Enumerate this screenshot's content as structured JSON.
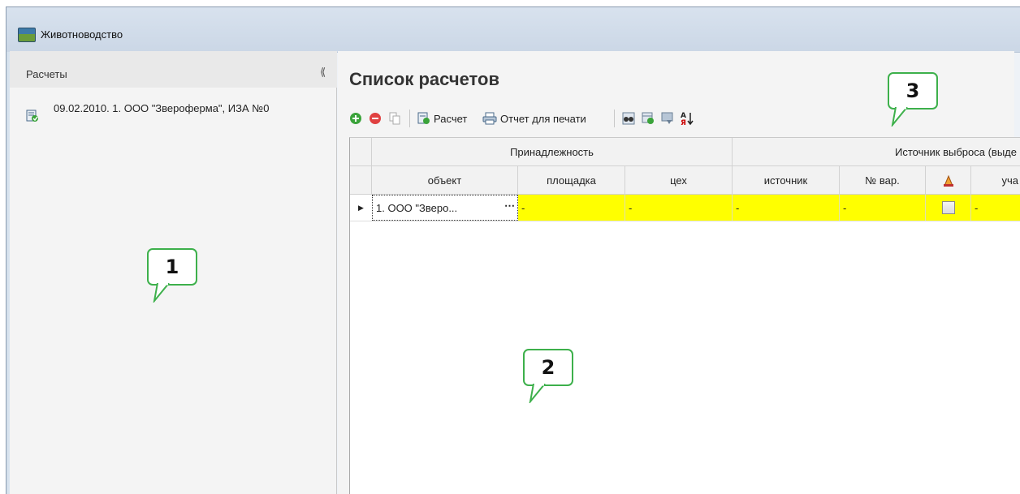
{
  "window": {
    "title": "Животноводство"
  },
  "left_panel": {
    "title": "Расчеты",
    "items": [
      {
        "label": "09.02.2010. 1. ООО \"Звероферма\", ИЗА №0"
      }
    ]
  },
  "main": {
    "title": "Список расчетов",
    "toolbar": {
      "calc_label": "Расчет",
      "print_label": "Отчет для печати"
    }
  },
  "grid": {
    "group_headers": [
      "Принадлежность",
      "Источник выброса (выде"
    ],
    "columns": [
      "объект",
      "площадка",
      "цех",
      "источник",
      "№ вар.",
      "уча"
    ],
    "rows": [
      {
        "object": "1. ООО \"Зверо...",
        "site": "-",
        "shop": "-",
        "source": "-",
        "variant": "-",
        "checked": false,
        "section": "-"
      }
    ],
    "row_highlight_color": "#ffff00"
  },
  "callouts": [
    "1",
    "2",
    "3"
  ],
  "colors": {
    "callout_border": "#3db04b",
    "add": "#3aa33a",
    "delete": "#e04040"
  }
}
